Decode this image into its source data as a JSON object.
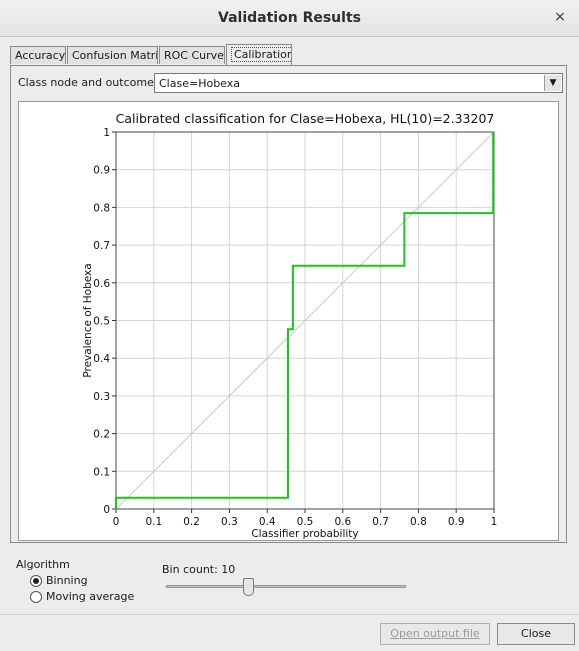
{
  "window": {
    "title": "Validation Results",
    "close_glyph": "×"
  },
  "tabs": [
    {
      "label": "Accuracy",
      "active": false
    },
    {
      "label": "Confusion Matrix",
      "active": false
    },
    {
      "label": "ROC Curve",
      "active": false
    },
    {
      "label": "Calibration",
      "active": true
    }
  ],
  "class_node": {
    "label": "Class node and outcome",
    "selected": "Clase=Hobexa"
  },
  "chart_data": {
    "type": "line",
    "title": "Calibrated classification for Clase=Hobexa, HL(10)=2.33207",
    "xlabel": "Classifier probability",
    "ylabel": "Prevalence of Hobexa",
    "xlim": [
      0,
      1
    ],
    "ylim": [
      0,
      1
    ],
    "xticks": [
      "0",
      "0.1",
      "0.2",
      "0.3",
      "0.4",
      "0.5",
      "0.6",
      "0.7",
      "0.8",
      "0.9",
      "1"
    ],
    "yticks": [
      "0",
      "0.1",
      "0.2",
      "0.3",
      "0.4",
      "0.5",
      "0.6",
      "0.7",
      "0.8",
      "0.9",
      "1"
    ],
    "grid": true,
    "reference_line": {
      "x": [
        0,
        1
      ],
      "y": [
        0,
        1
      ],
      "color": "#c8c8c8"
    },
    "series": [
      {
        "color": "#1ec31e",
        "x": [
          0.0,
          0.0,
          0.455,
          0.455,
          0.468,
          0.468,
          0.763,
          0.763,
          0.998,
          0.998
        ],
        "y": [
          0.0,
          0.03,
          0.03,
          0.477,
          0.477,
          0.645,
          0.645,
          0.785,
          0.785,
          1.0
        ]
      }
    ]
  },
  "algorithm": {
    "label": "Algorithm",
    "options": [
      {
        "label": "Binning",
        "selected": true
      },
      {
        "label": "Moving average",
        "selected": false
      }
    ]
  },
  "bin_count": {
    "label": "Bin count: 10",
    "value": 10,
    "min": 1,
    "max": 30
  },
  "buttons": {
    "open_output": "Open output file",
    "close": "Close"
  },
  "colors": {
    "series": "#1ec31e",
    "grid": "#d4d4d4",
    "background": "#ececec"
  }
}
